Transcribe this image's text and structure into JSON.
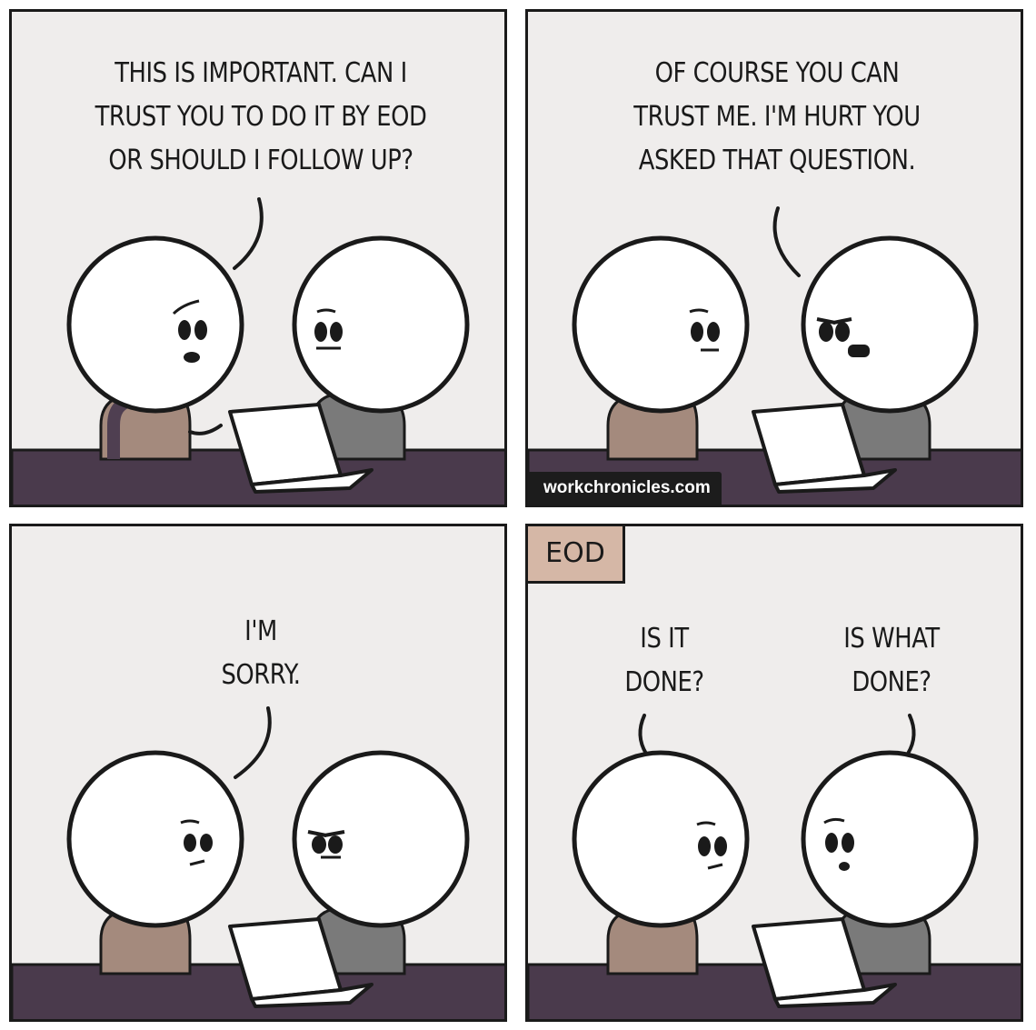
{
  "comic": {
    "panels": [
      {
        "speech": "THIS IS IMPORTANT. CAN I\nTRUST YOU TO DO IT BY EOD\nOR SHOULD I FOLLOW UP?"
      },
      {
        "speech": "OF COURSE YOU CAN\nTRUST ME. I'M HURT YOU\nASKED THAT QUESTION.",
        "watermark": "workchronicles.com"
      },
      {
        "speech": "I'M\nSORRY."
      },
      {
        "caption": "EOD",
        "speech_left": "IS IT\nDONE?",
        "speech_right": "IS WHAT\nDONE?"
      }
    ]
  },
  "colors": {
    "panel_background": "#efedec",
    "desk": "#4a3a4c",
    "outline": "#1a1a1a",
    "caption_box": "#d5b7a6",
    "body_skin": "#a48a7d",
    "body_gray": "#7a7a7a"
  }
}
